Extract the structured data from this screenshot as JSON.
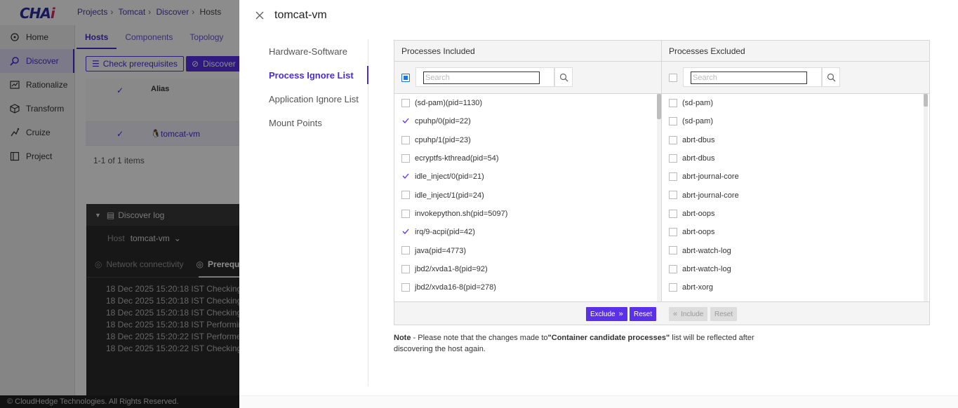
{
  "app": {
    "breadcrumb": [
      "Projects",
      "Tomcat",
      "Discover",
      "Hosts"
    ],
    "sidebar": [
      {
        "label": "Home",
        "icon": "home-icon"
      },
      {
        "label": "Discover",
        "icon": "discover-icon",
        "active": true
      },
      {
        "label": "Rationalize",
        "icon": "rationalize-icon"
      },
      {
        "label": "Transform",
        "icon": "transform-icon"
      },
      {
        "label": "Cruize",
        "icon": "cruize-icon"
      },
      {
        "label": "Project",
        "icon": "project-icon"
      }
    ],
    "content_tabs": [
      "Hosts",
      "Components",
      "Topology"
    ],
    "check_prereq_label": "Check prerequisites",
    "discover_label": "Discover",
    "table": {
      "alias_header": "Alias",
      "row_alias": "tomcat-vm",
      "pagination": "1-1 of 1 items"
    },
    "log": {
      "title": "Discover log",
      "host_label": "Host",
      "host_value": "tomcat-vm",
      "tab1": "Network connectivity",
      "tab2": "Prerequ",
      "lines": [
        "18 Dec 2025 15:20:18 IST Checking",
        "18 Dec 2025 15:20:18 IST Checking",
        "18 Dec 2025 15:20:18 IST Checking",
        "18 Dec 2025 15:20:18 IST Performin",
        "18 Dec 2025 15:20:22 IST Performed",
        "18 Dec 2025 15:20:22 IST Checking"
      ]
    },
    "footer": "© CloudHedge Technologies. All Rights Reserved."
  },
  "drawer": {
    "title": "tomcat-vm",
    "side_tabs": [
      "Hardware-Software",
      "Process Ignore List",
      "Application Ignore List",
      "Mount Points"
    ],
    "active_side_tab": "Process Ignore List",
    "included": {
      "header": "Processes Included",
      "search_placeholder": "Search",
      "items": [
        {
          "label": "(sd-pam)(pid=1130)",
          "checked": false
        },
        {
          "label": "cpuhp/0(pid=22)",
          "checked": true
        },
        {
          "label": "cpuhp/1(pid=23)",
          "checked": false
        },
        {
          "label": "ecryptfs-kthread(pid=54)",
          "checked": false
        },
        {
          "label": "idle_inject/0(pid=21)",
          "checked": true
        },
        {
          "label": "idle_inject/1(pid=24)",
          "checked": false
        },
        {
          "label": "invokepython.sh(pid=5097)",
          "checked": false
        },
        {
          "label": "irq/9-acpi(pid=42)",
          "checked": true
        },
        {
          "label": "java(pid=4773)",
          "checked": false
        },
        {
          "label": "jbd2/xvda1-8(pid=92)",
          "checked": false
        },
        {
          "label": "jbd2/xvda16-8(pid=278)",
          "checked": false
        }
      ],
      "exclude_label": "Exclude",
      "reset_label": "Reset"
    },
    "excluded": {
      "header": "Processes Excluded",
      "search_placeholder": "Search",
      "items": [
        {
          "label": "(sd-pam)"
        },
        {
          "label": "(sd-pam)"
        },
        {
          "label": "abrt-dbus"
        },
        {
          "label": "abrt-dbus"
        },
        {
          "label": "abrt-journal-core"
        },
        {
          "label": "abrt-journal-core"
        },
        {
          "label": "abrt-oops"
        },
        {
          "label": "abrt-oops"
        },
        {
          "label": "abrt-watch-log"
        },
        {
          "label": "abrt-watch-log"
        },
        {
          "label": "abrt-xorg"
        }
      ],
      "include_label": "Include",
      "reset_label": "Reset"
    },
    "note": {
      "prefix": "Note",
      "text1": " - Please note that the changes made to",
      "highlight": "\"Container candidate processes\"",
      "text2": " list will be reflected after discovering the host again."
    }
  },
  "colors": {
    "accent": "#5a30e8",
    "active_text": "#4a2bd8"
  }
}
